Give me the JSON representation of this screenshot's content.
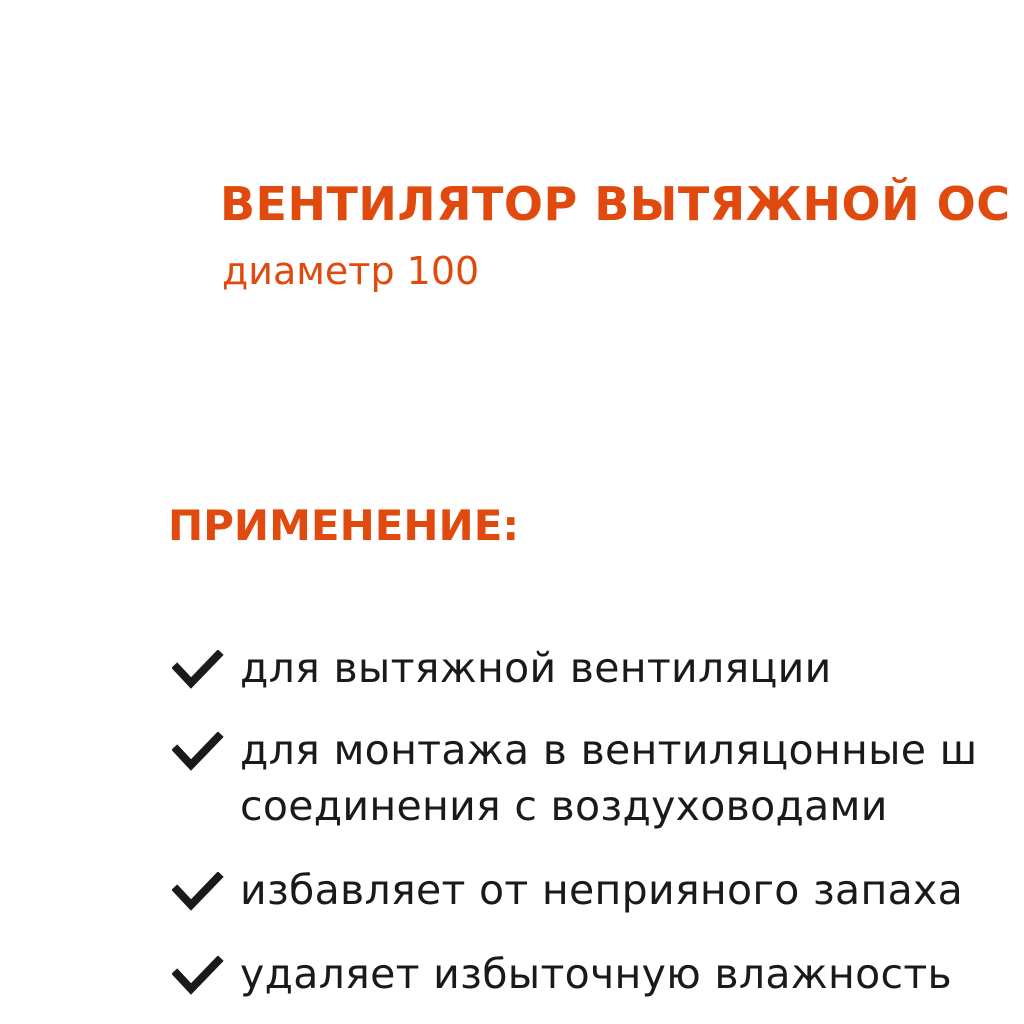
{
  "header": {
    "title": "ВЕНТИЛЯТОР ВЫТЯЖНОЙ ОС",
    "subtitle": "диаметр 100"
  },
  "section": {
    "heading": "ПРИМЕНЕНИЕ:"
  },
  "features": [
    {
      "icon": "check-icon",
      "lines": [
        "для вытяжной вентиляции"
      ]
    },
    {
      "icon": "check-icon",
      "lines": [
        "для монтажа в вентиляцонные ш",
        "соединения с воздуховодами"
      ]
    },
    {
      "icon": "check-icon",
      "lines": [
        "избавляет от неприяного запаха"
      ]
    },
    {
      "icon": "check-icon",
      "lines": [
        "удаляет избыточную влажность"
      ]
    }
  ],
  "colors": {
    "accent": "#e04a0f",
    "text": "#1a1a1a",
    "background": "#ffffff"
  }
}
